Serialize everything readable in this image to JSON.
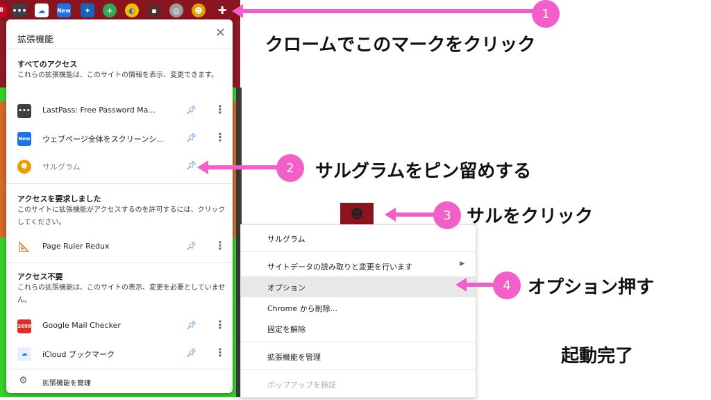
{
  "toolbar": {
    "badge_count": "8",
    "new_badge": "New"
  },
  "popup": {
    "title": "拡張機能",
    "close": "×",
    "sections": [
      {
        "heading": "すべてのアクセス",
        "description": "これらの拡張機能は、このサイトの情報を表示、変更できます。"
      },
      {
        "heading": "アクセスを要求しました",
        "description": "このサイトに拡張機能がアクセスするのを許可するには、クリックしてください。"
      },
      {
        "heading": "アクセス不要",
        "description": "これらの拡張機能は、このサイトの表示、変更を必要としていません。"
      }
    ],
    "extensions": [
      {
        "name": "LastPass: Free Password Ma...",
        "icon": "lastpass-icon",
        "pinned": true
      },
      {
        "name": "ウェブページ全体をスクリーンシ...",
        "icon": "screenshot-new-icon",
        "icon_label": "New",
        "pinned": true
      },
      {
        "name": "サルグラム",
        "icon": "monkey-icon",
        "pinned": true
      },
      {
        "name": "Page Ruler Redux",
        "icon": "ruler-icon",
        "pinned": false
      },
      {
        "name": "Google Mail Checker",
        "icon": "gmail-icon",
        "icon_label": "2698",
        "pinned": true
      },
      {
        "name": "iCloud ブックマーク",
        "icon": "icloud-icon",
        "pinned": true
      }
    ],
    "manage_label": "拡張機能を管理"
  },
  "context_menu": {
    "items": [
      {
        "label": "サルグラム"
      },
      {
        "label": "サイトデータの読み取りと変更を行います",
        "submenu": true
      },
      {
        "label": "オプション",
        "highlighted": true
      },
      {
        "label": "Chrome から削除..."
      },
      {
        "label": "固定を解除"
      },
      {
        "label": "拡張機能を管理"
      },
      {
        "label": "ポップアップを検証",
        "disabled": true
      }
    ]
  },
  "annotations": {
    "step1": {
      "number": "1",
      "text": "クロームでこのマークをクリック"
    },
    "step2": {
      "number": "2",
      "text": "サルグラムをピン留めする"
    },
    "step3": {
      "number": "3",
      "text": "サルをクリック"
    },
    "step4": {
      "number": "4",
      "text": "オプション押す"
    },
    "done": "起動完了"
  },
  "colors": {
    "annotation_pink": "#f25fc8",
    "pin_blue": "#1a73e8",
    "toolbar_red": "#8a1420",
    "page_green": "#37d22a"
  }
}
